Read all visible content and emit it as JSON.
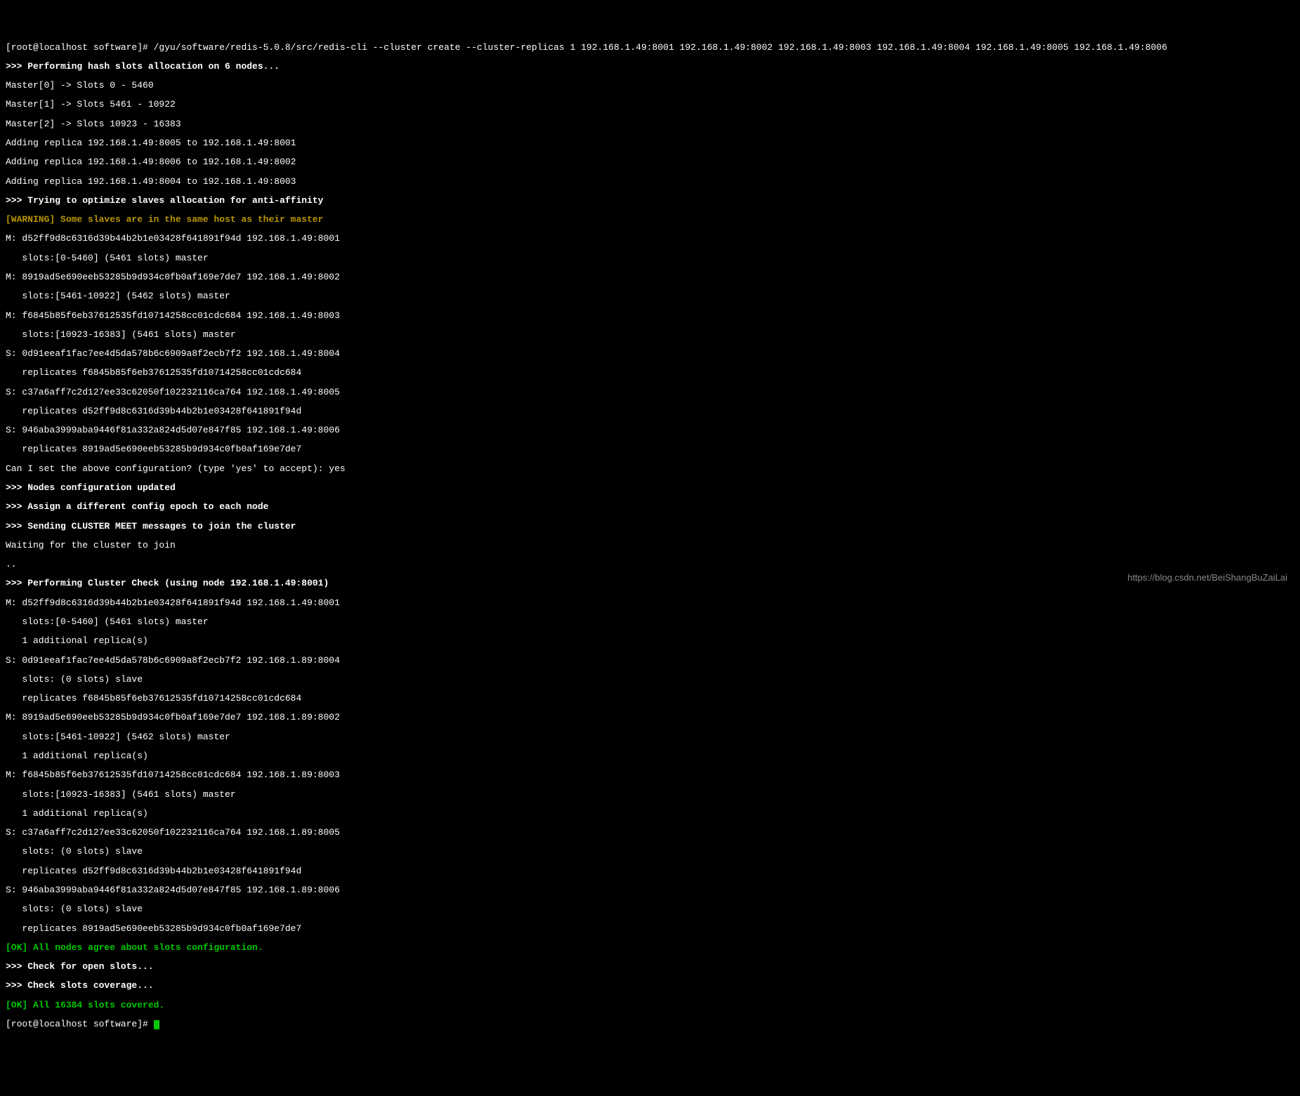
{
  "prompt1": "[root@localhost software]# /gyu/software/redis-5.0.8/src/redis-cli --cluster create --cluster-replicas 1 192.168.1.49:8001 192.168.1.49:8002 192.168.1.49:8003 192.168.1.49:8004 192.168.1.49:8005 192.168.1.49:8006",
  "b1": ">>> Performing hash slots allocation on 6 nodes...",
  "l2": "Master[0] -> Slots 0 - 5460",
  "l3": "Master[1] -> Slots 5461 - 10922",
  "l4": "Master[2] -> Slots 10923 - 16383",
  "l5": "Adding replica 192.168.1.49:8005 to 192.168.1.49:8001",
  "l6": "Adding replica 192.168.1.49:8006 to 192.168.1.49:8002",
  "l7": "Adding replica 192.168.1.49:8004 to 192.168.1.49:8003",
  "b2": ">>> Trying to optimize slaves allocation for anti-affinity",
  "warn": "[WARNING] Some slaves are in the same host as their master",
  "l8": "M: d52ff9d8c6316d39b44b2b1e03428f641891f94d 192.168.1.49:8001",
  "l9": "   slots:[0-5460] (5461 slots) master",
  "l10": "M: 8919ad5e690eeb53285b9d934c0fb0af169e7de7 192.168.1.49:8002",
  "l11": "   slots:[5461-10922] (5462 slots) master",
  "l12": "M: f6845b85f6eb37612535fd10714258cc01cdc684 192.168.1.49:8003",
  "l13": "   slots:[10923-16383] (5461 slots) master",
  "l14": "S: 0d91eeaf1fac7ee4d5da578b6c6909a8f2ecb7f2 192.168.1.49:8004",
  "l15": "   replicates f6845b85f6eb37612535fd10714258cc01cdc684",
  "l16": "S: c37a6aff7c2d127ee33c62050f102232116ca764 192.168.1.49:8005",
  "l17": "   replicates d52ff9d8c6316d39b44b2b1e03428f641891f94d",
  "l18": "S: 946aba3999aba9446f81a332a824d5d07e847f85 192.168.1.49:8006",
  "l19": "   replicates 8919ad5e690eeb53285b9d934c0fb0af169e7de7",
  "l20": "Can I set the above configuration? (type 'yes' to accept): yes",
  "b3": ">>> Nodes configuration updated",
  "b4": ">>> Assign a different config epoch to each node",
  "b5": ">>> Sending CLUSTER MEET messages to join the cluster",
  "l21": "Waiting for the cluster to join",
  "l22": "..",
  "b6": ">>> Performing Cluster Check (using node 192.168.1.49:8001)",
  "l23": "M: d52ff9d8c6316d39b44b2b1e03428f641891f94d 192.168.1.49:8001",
  "l24": "   slots:[0-5460] (5461 slots) master",
  "l25": "   1 additional replica(s)",
  "l26": "S: 0d91eeaf1fac7ee4d5da578b6c6909a8f2ecb7f2 192.168.1.89:8004",
  "l27": "   slots: (0 slots) slave",
  "l28": "   replicates f6845b85f6eb37612535fd10714258cc01cdc684",
  "l29": "M: 8919ad5e690eeb53285b9d934c0fb0af169e7de7 192.168.1.89:8002",
  "l30": "   slots:[5461-10922] (5462 slots) master",
  "l31": "   1 additional replica(s)",
  "l32": "M: f6845b85f6eb37612535fd10714258cc01cdc684 192.168.1.89:8003",
  "l33": "   slots:[10923-16383] (5461 slots) master",
  "l34": "   1 additional replica(s)",
  "l35": "S: c37a6aff7c2d127ee33c62050f102232116ca764 192.168.1.89:8005",
  "l36": "   slots: (0 slots) slave",
  "l37": "   replicates d52ff9d8c6316d39b44b2b1e03428f641891f94d",
  "l38": "S: 946aba3999aba9446f81a332a824d5d07e847f85 192.168.1.89:8006",
  "l39": "   slots: (0 slots) slave",
  "l40": "   replicates 8919ad5e690eeb53285b9d934c0fb0af169e7de7",
  "ok1": "[OK] All nodes agree about slots configuration.",
  "b7": ">>> Check for open slots...",
  "b8": ">>> Check slots coverage...",
  "ok2": "[OK] All 16384 slots covered.",
  "prompt2": "[root@localhost software]# ",
  "watermark": "https://blog.csdn.net/BeiShangBuZaiLai"
}
